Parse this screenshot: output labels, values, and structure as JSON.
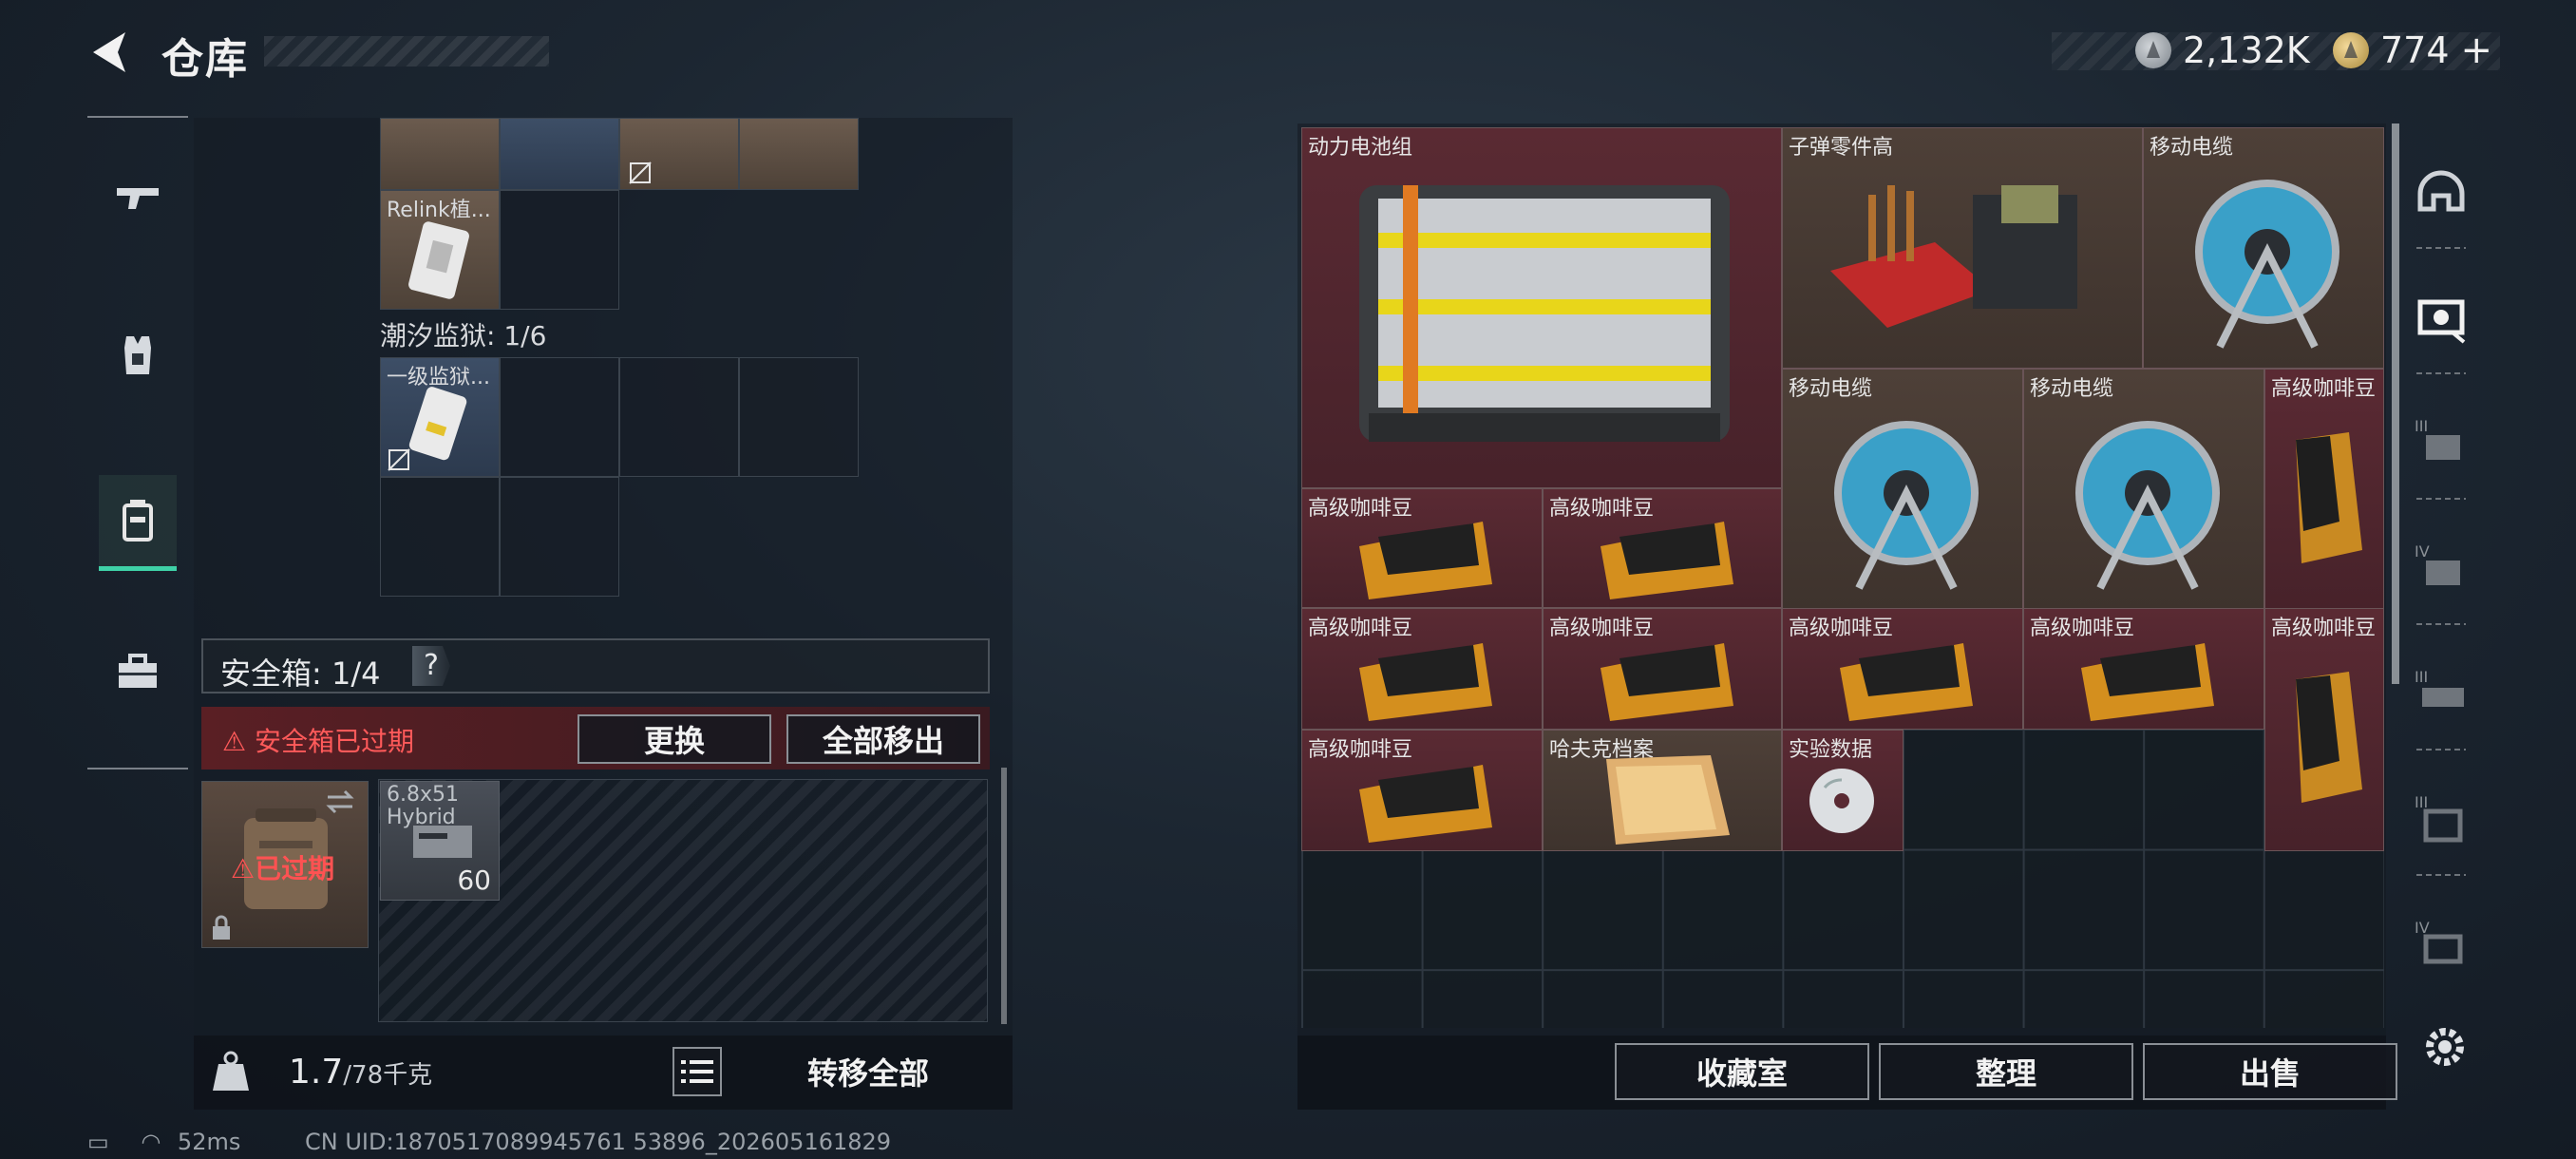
{
  "header": {
    "title": "仓库"
  },
  "currency": {
    "silver": "2,132K",
    "gold": "774",
    "plus": "+"
  },
  "left_nav": {
    "items": [
      {
        "name": "weapons",
        "icon": "gun-icon"
      },
      {
        "name": "armor",
        "icon": "vest-icon"
      },
      {
        "name": "backpack",
        "icon": "backpack-icon",
        "active": true
      },
      {
        "name": "case",
        "icon": "toolbox-icon"
      }
    ]
  },
  "inventory": {
    "top_item_label": "Relink植...",
    "section_label": "潮汐监狱: 1/6",
    "prison_item_label": "一级监狱..."
  },
  "safebox": {
    "label": "安全箱: 1/4",
    "help": "?",
    "expired_warning": "安全箱已过期",
    "replace_button": "更换",
    "move_all_button": "全部移出",
    "case_status": "已过期",
    "ammo": {
      "name_line1": "6.8x51",
      "name_line2": "Hybrid",
      "count": "60"
    }
  },
  "left_footer": {
    "weight_current": "1.7",
    "weight_max": "/78千克",
    "transfer_all_button": "转移全部"
  },
  "stash_items": [
    {
      "label": "动力电池组",
      "kind": "battery"
    },
    {
      "label": "子弹零件高",
      "kind": "ammo-parts"
    },
    {
      "label": "移动电缆",
      "kind": "cable"
    },
    {
      "label": "移动电缆",
      "kind": "cable"
    },
    {
      "label": "移动电缆",
      "kind": "cable"
    },
    {
      "label": "高级咖啡豆",
      "kind": "coffee-tall"
    },
    {
      "label": "高级咖啡豆",
      "kind": "coffee"
    },
    {
      "label": "高级咖啡豆",
      "kind": "coffee"
    },
    {
      "label": "高级咖啡豆",
      "kind": "coffee"
    },
    {
      "label": "高级咖啡豆",
      "kind": "coffee"
    },
    {
      "label": "高级咖啡豆",
      "kind": "coffee"
    },
    {
      "label": "高级咖啡豆",
      "kind": "coffee"
    },
    {
      "label": "高级咖啡豆",
      "kind": "coffee-tall"
    },
    {
      "label": "高级咖啡豆",
      "kind": "coffee"
    },
    {
      "label": "哈夫克档案",
      "kind": "folder"
    },
    {
      "label": "实验数据",
      "kind": "disc"
    }
  ],
  "right_footer": {
    "collection_button": "收藏室",
    "sort_button": "整理",
    "sell_button": "出售"
  },
  "right_tabs": [
    "helmet-icon",
    "gear-box-icon",
    "level-3-box-icon",
    "level-4-box-icon",
    "level-3-rig-icon",
    "level-3-case-icon",
    "level-4-case-icon"
  ],
  "status": {
    "ping": "52ms",
    "uid": "CN UID:1870517089945761 53896_202605161829"
  },
  "colors": {
    "accent": "#3fd1a7",
    "expired_red": "#ff5a5a",
    "item_red": "#5a2a33"
  }
}
